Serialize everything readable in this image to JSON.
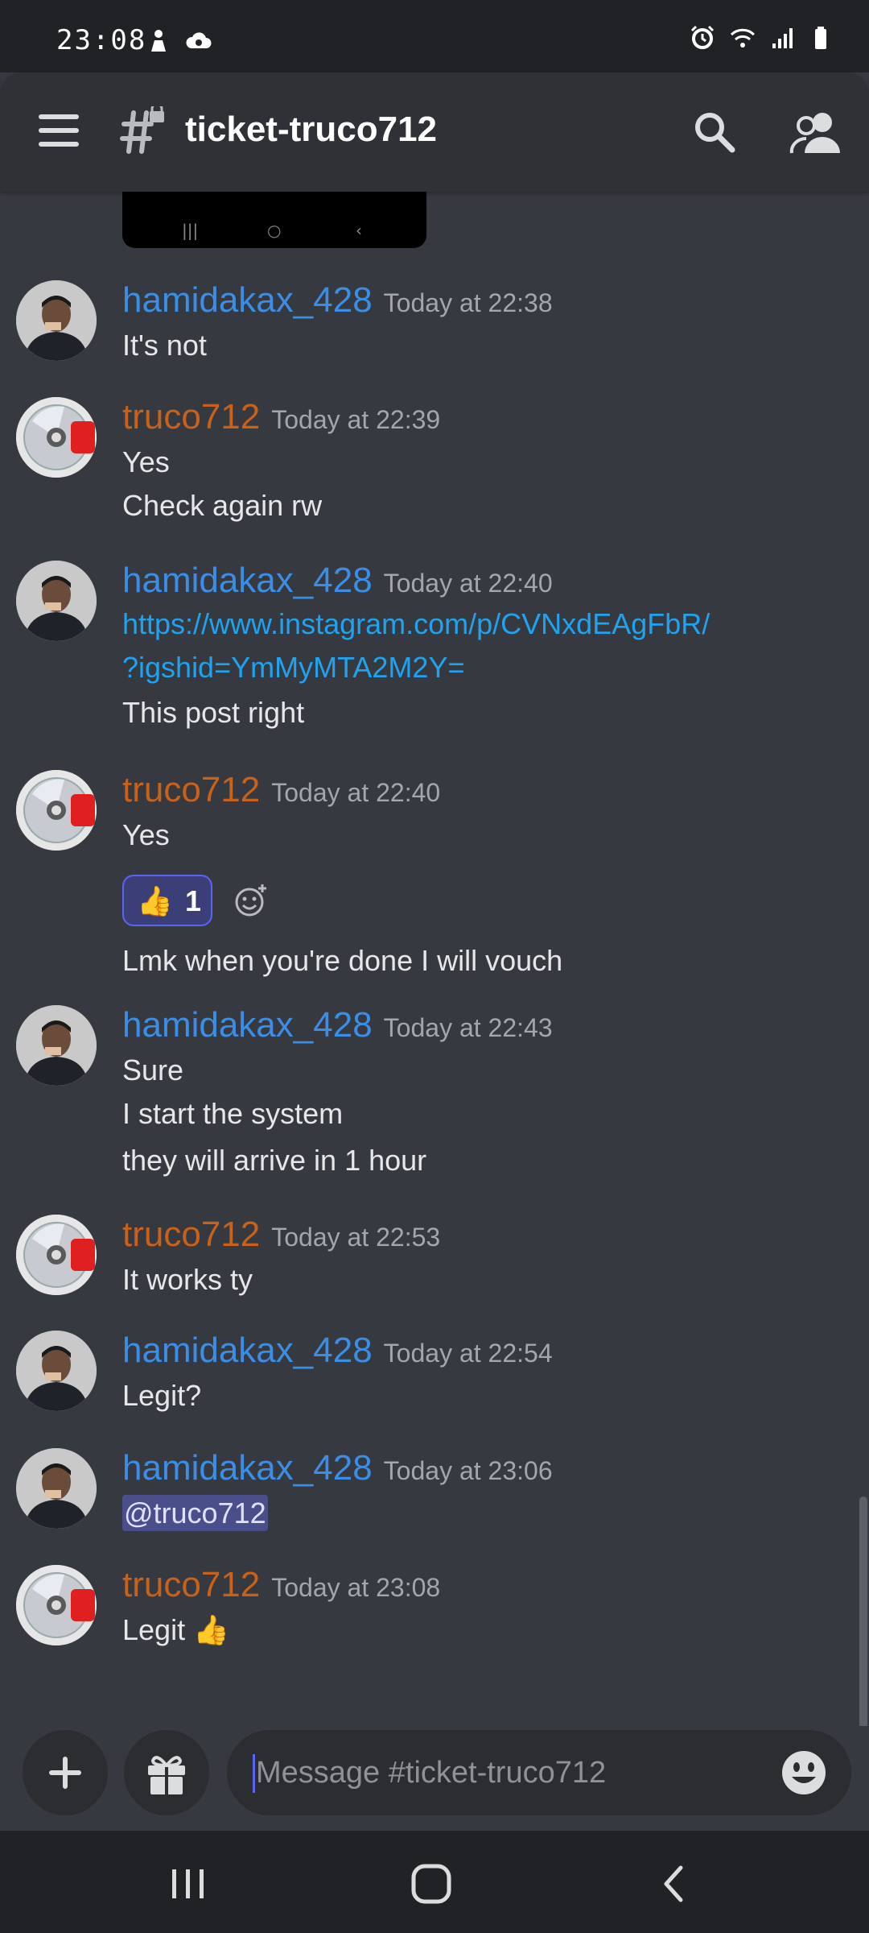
{
  "status_bar": {
    "time": "23:08"
  },
  "header": {
    "channel_name": "ticket-truco712",
    "icons": [
      "menu-icon",
      "channel-lock-hash-icon",
      "search-icon",
      "members-icon"
    ]
  },
  "messages": [
    {
      "author": "hamidakax_428",
      "timestamp": "Today at 22:38",
      "lines": [
        "It's not"
      ]
    },
    {
      "author": "truco712",
      "timestamp": "Today at 22:39",
      "lines": [
        "Yes",
        "Check again rw"
      ]
    },
    {
      "author": "hamidakax_428",
      "timestamp": "Today at 22:40",
      "link_lines": [
        "https://www.instagram.com/p/CVNxdEAgFbR/",
        "?igshid=YmMyMTA2M2Y="
      ],
      "lines": [
        "This post right"
      ]
    },
    {
      "author": "truco712",
      "timestamp": "Today at 22:40",
      "lines": [
        "Yes"
      ],
      "reaction": {
        "emoji": "👍",
        "count": "1"
      },
      "after_lines": [
        "Lmk when you're done I will vouch"
      ]
    },
    {
      "author": "hamidakax_428",
      "timestamp": "Today at 22:43",
      "lines": [
        "Sure",
        "I start the system",
        "they will arrive in 1 hour"
      ]
    },
    {
      "author": "truco712",
      "timestamp": "Today at 22:53",
      "lines": [
        "It works ty"
      ]
    },
    {
      "author": "hamidakax_428",
      "timestamp": "Today at 22:54",
      "lines": [
        "Legit?"
      ]
    },
    {
      "author": "hamidakax_428",
      "timestamp": "Today at 23:06",
      "mention": "@truco712"
    },
    {
      "author": "truco712",
      "timestamp": "Today at 23:08",
      "lines": [
        "Legit"
      ],
      "trailing_emoji": "👍"
    }
  ],
  "composer": {
    "placeholder": "Message #ticket-truco712"
  },
  "colors": {
    "background": "#36393f",
    "header": "#2f3136",
    "name_blue": "#3a8ee6",
    "name_orange": "#c8611a",
    "link": "#1fa3f0",
    "blurple": "#5865f2"
  }
}
